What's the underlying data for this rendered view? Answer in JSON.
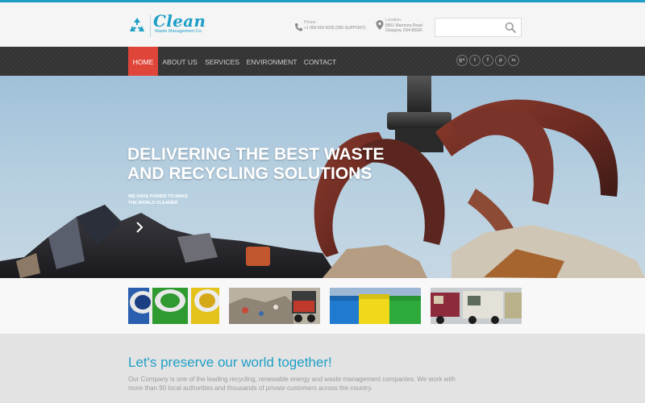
{
  "brand": {
    "name": "Clean",
    "tagline": "Waste Management Co.",
    "accent_color": "#1e9fc6",
    "highlight_color": "#e0453a"
  },
  "contact": {
    "phone_label": "Phone:",
    "phone_value": "+1 959 603 6035 (595-SUPPORT)",
    "location_label": "Location:",
    "location_line1": "8901 Marmora Road",
    "location_line2": "Glasgow, D04 89GR"
  },
  "search": {
    "placeholder": "",
    "icon": "search-icon"
  },
  "nav": {
    "items": [
      {
        "label": "Home",
        "active": true
      },
      {
        "label": "About Us",
        "active": false
      },
      {
        "label": "Services",
        "active": false
      },
      {
        "label": "Environment",
        "active": false
      },
      {
        "label": "Contact",
        "active": false
      }
    ],
    "social": [
      {
        "icon": "google-plus-icon",
        "glyph": "g+"
      },
      {
        "icon": "twitter-icon",
        "glyph": "t"
      },
      {
        "icon": "facebook-icon",
        "glyph": "f"
      },
      {
        "icon": "pinterest-icon",
        "glyph": "p"
      },
      {
        "icon": "linkedin-icon",
        "glyph": "in"
      }
    ]
  },
  "hero": {
    "title_line1": "DELIVERING THE BEST WASTE",
    "title_line2": "AND RECYCLING SOLUTIONS",
    "subtitle_line1": "WE HAVE POWER TO MAKE",
    "subtitle_line2": "THE WORLD CLEANER"
  },
  "slider": {
    "thumbnails": [
      "recycling-bins",
      "landfill-truck",
      "colored-containers",
      "garbage-trucks"
    ],
    "dots": 4,
    "active_dot": 0
  },
  "intro": {
    "title": "Let's preserve our world together!",
    "text": "Our Company is one of the leading recycling, renewable energy and waste management companies. We work with more than 90 local authorities and thousands of private customers across the country."
  }
}
